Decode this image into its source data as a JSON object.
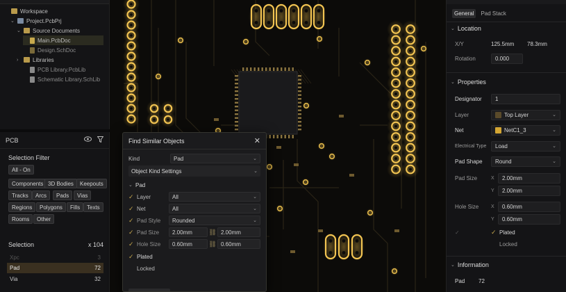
{
  "project_tree": {
    "items": [
      {
        "label": "Workspace",
        "indent": 0,
        "icon": "folder-icon",
        "chevron": ""
      },
      {
        "label": "Project.PcbPrj",
        "indent": 1,
        "icon": "project-icon",
        "chevron": "v"
      },
      {
        "label": "Source Documents",
        "indent": 2,
        "icon": "folder-icon",
        "chevron": "v"
      },
      {
        "label": "Main.PcbDoc",
        "indent": 3,
        "icon": "pcb-doc-icon",
        "chevron": "",
        "selected": true
      },
      {
        "label": "Design.SchDoc",
        "indent": 3,
        "icon": "sch-doc-icon",
        "chevron": "",
        "dim": true
      },
      {
        "label": "Libraries",
        "indent": 2,
        "icon": "folder-icon",
        "chevron": ">"
      },
      {
        "label": "PCB Library.PcbLib",
        "indent": 3,
        "icon": "library-icon",
        "chevron": "",
        "dim": true
      },
      {
        "label": "Schematic Library.SchLib",
        "indent": 3,
        "icon": "library-icon",
        "chevron": "",
        "dim": true
      }
    ]
  },
  "pcb_panel": {
    "title": "PCB",
    "selection_filter_title": "Selection Filter",
    "filter_chips": [
      "All - On",
      "Components",
      "3D Bodies",
      "Keepouts",
      "Tracks",
      "Arcs",
      "Pads",
      "Vias",
      "Regions",
      "Polygons",
      "Fills",
      "Texts",
      "Rooms",
      "Other"
    ],
    "selection_label": "Selection",
    "selection_count": "x 104",
    "selection_rows": [
      {
        "label": "Xpc",
        "count": "3",
        "state": "faded"
      },
      {
        "label": "Pad",
        "count": "72",
        "state": "on"
      },
      {
        "label": "Via",
        "count": "32",
        "state": "normal"
      }
    ]
  },
  "dialog": {
    "title": "Find Similar Objects",
    "kind_label": "Kind",
    "kind_value": "Pad",
    "settings_label": "Object Kind Settings",
    "group_label": "Pad",
    "rows": [
      {
        "label": "Layer",
        "value": "All",
        "checked": true
      },
      {
        "label": "Net",
        "value": "All",
        "checked": true
      },
      {
        "label": "Pad Style",
        "value": "Rounded",
        "checked": true
      },
      {
        "label": "Pad Size",
        "value": "2.00mm",
        "value2": "2.00mm",
        "checked": true
      },
      {
        "label": "Hole Size",
        "value": "0.60mm",
        "value2": "0.60mm",
        "checked": true
      }
    ],
    "plated_label": "Plated",
    "locked_label": "Locked"
  },
  "properties": {
    "tabs": [
      "General",
      "Pad Stack"
    ],
    "location": {
      "title": "Location",
      "xy_label": "X/Y",
      "x": "125.5mm",
      "y": "78.3mm",
      "rotation_label": "Rotation",
      "rotation": "0.000"
    },
    "props": {
      "title": "Properties",
      "designator_label": "Designator",
      "designator": "1",
      "layer_label": "Layer",
      "layer": "Top Layer",
      "layer_color": "#5a4a2a",
      "net_label": "Net",
      "net": "NetC1_3",
      "net_color": "#d4a633",
      "electrical_type_label": "Electrical Type",
      "electrical_type": "Load",
      "pad_shape_label": "Pad Shape",
      "pad_shape": "Round",
      "pad_size_label": "Pad Size",
      "pad_size_x": "2.00mm",
      "pad_size_y": "2.00mm",
      "hole_size_label": "Hole Size",
      "hole_size_x": "0.60mm",
      "hole_size_y": "0.60mm",
      "plated_label": "Plated",
      "locked_label": "Locked"
    },
    "information": {
      "title": "Information",
      "pad_label": "Pad",
      "pad_value": "72"
    }
  }
}
